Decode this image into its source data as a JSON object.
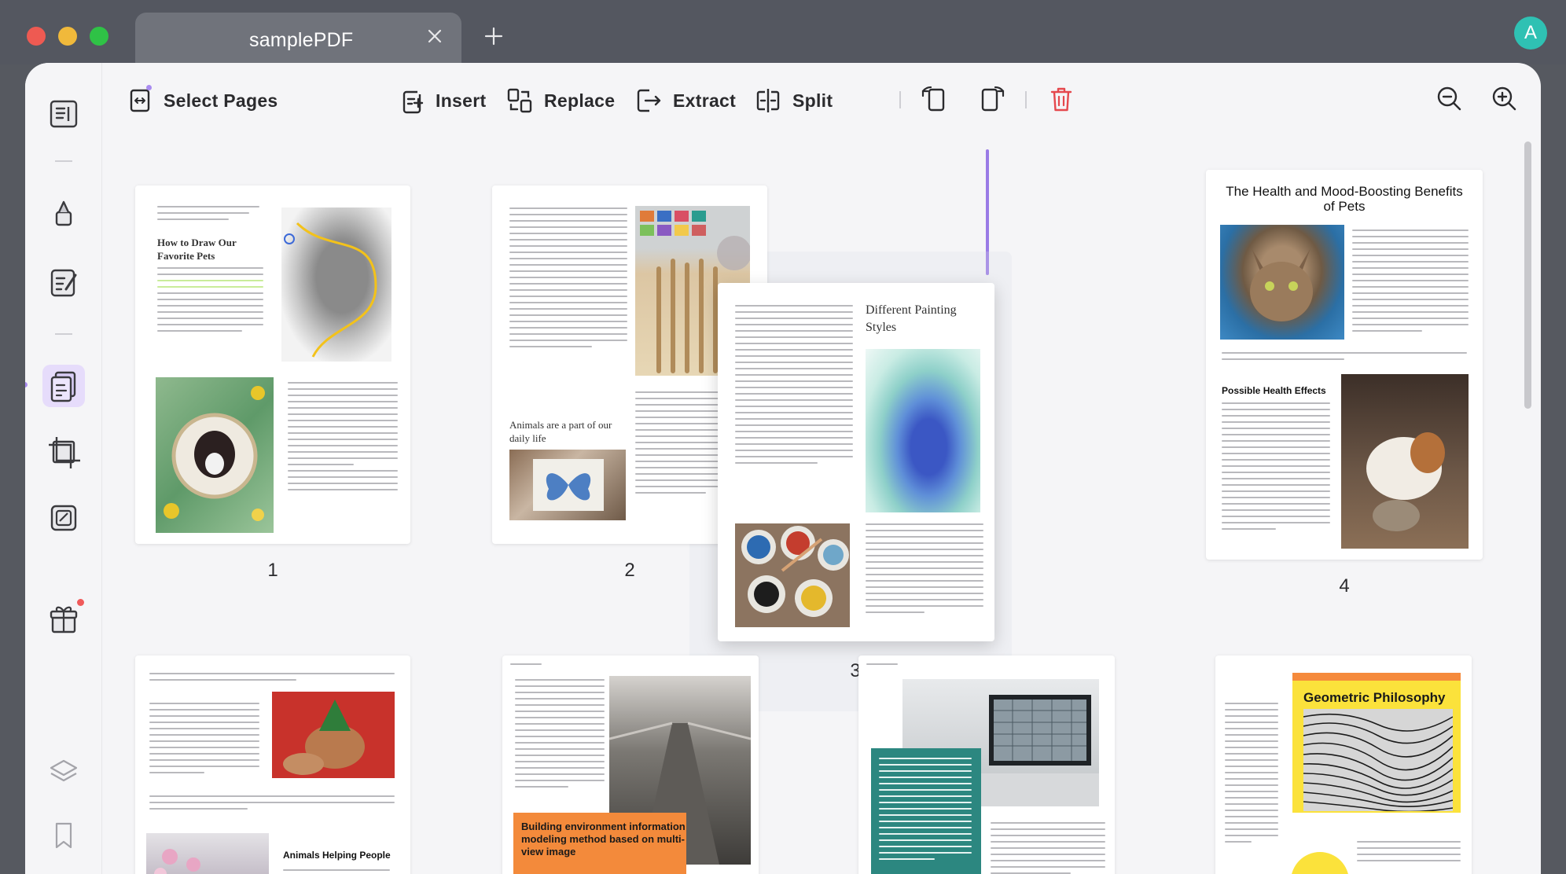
{
  "tab": {
    "title": "samplePDF"
  },
  "user": {
    "avatar_letter": "A"
  },
  "toolbar": {
    "select_pages": "Select Pages",
    "insert": "Insert",
    "replace": "Replace",
    "extract": "Extract",
    "split": "Split"
  },
  "pages": [
    {
      "number": "1",
      "heading": "How to Draw Our Favorite Pets"
    },
    {
      "number": "2",
      "heading": "Animals are a part of our daily life"
    },
    {
      "number": "3",
      "heading": "Different Painting Styles"
    },
    {
      "number": "4",
      "title": "The Health and Mood-Boosting Benefits of Pets",
      "subheading": "Possible Health Effects"
    },
    {
      "heading": "Animals Helping People"
    },
    {
      "heading": "Building environment information modeling method based on multi-view image"
    },
    {
      "heading": ""
    },
    {
      "heading": "Geometric Philosophy"
    }
  ],
  "colors": {
    "accent": "#9a7be6",
    "delete": "#e5484d"
  }
}
